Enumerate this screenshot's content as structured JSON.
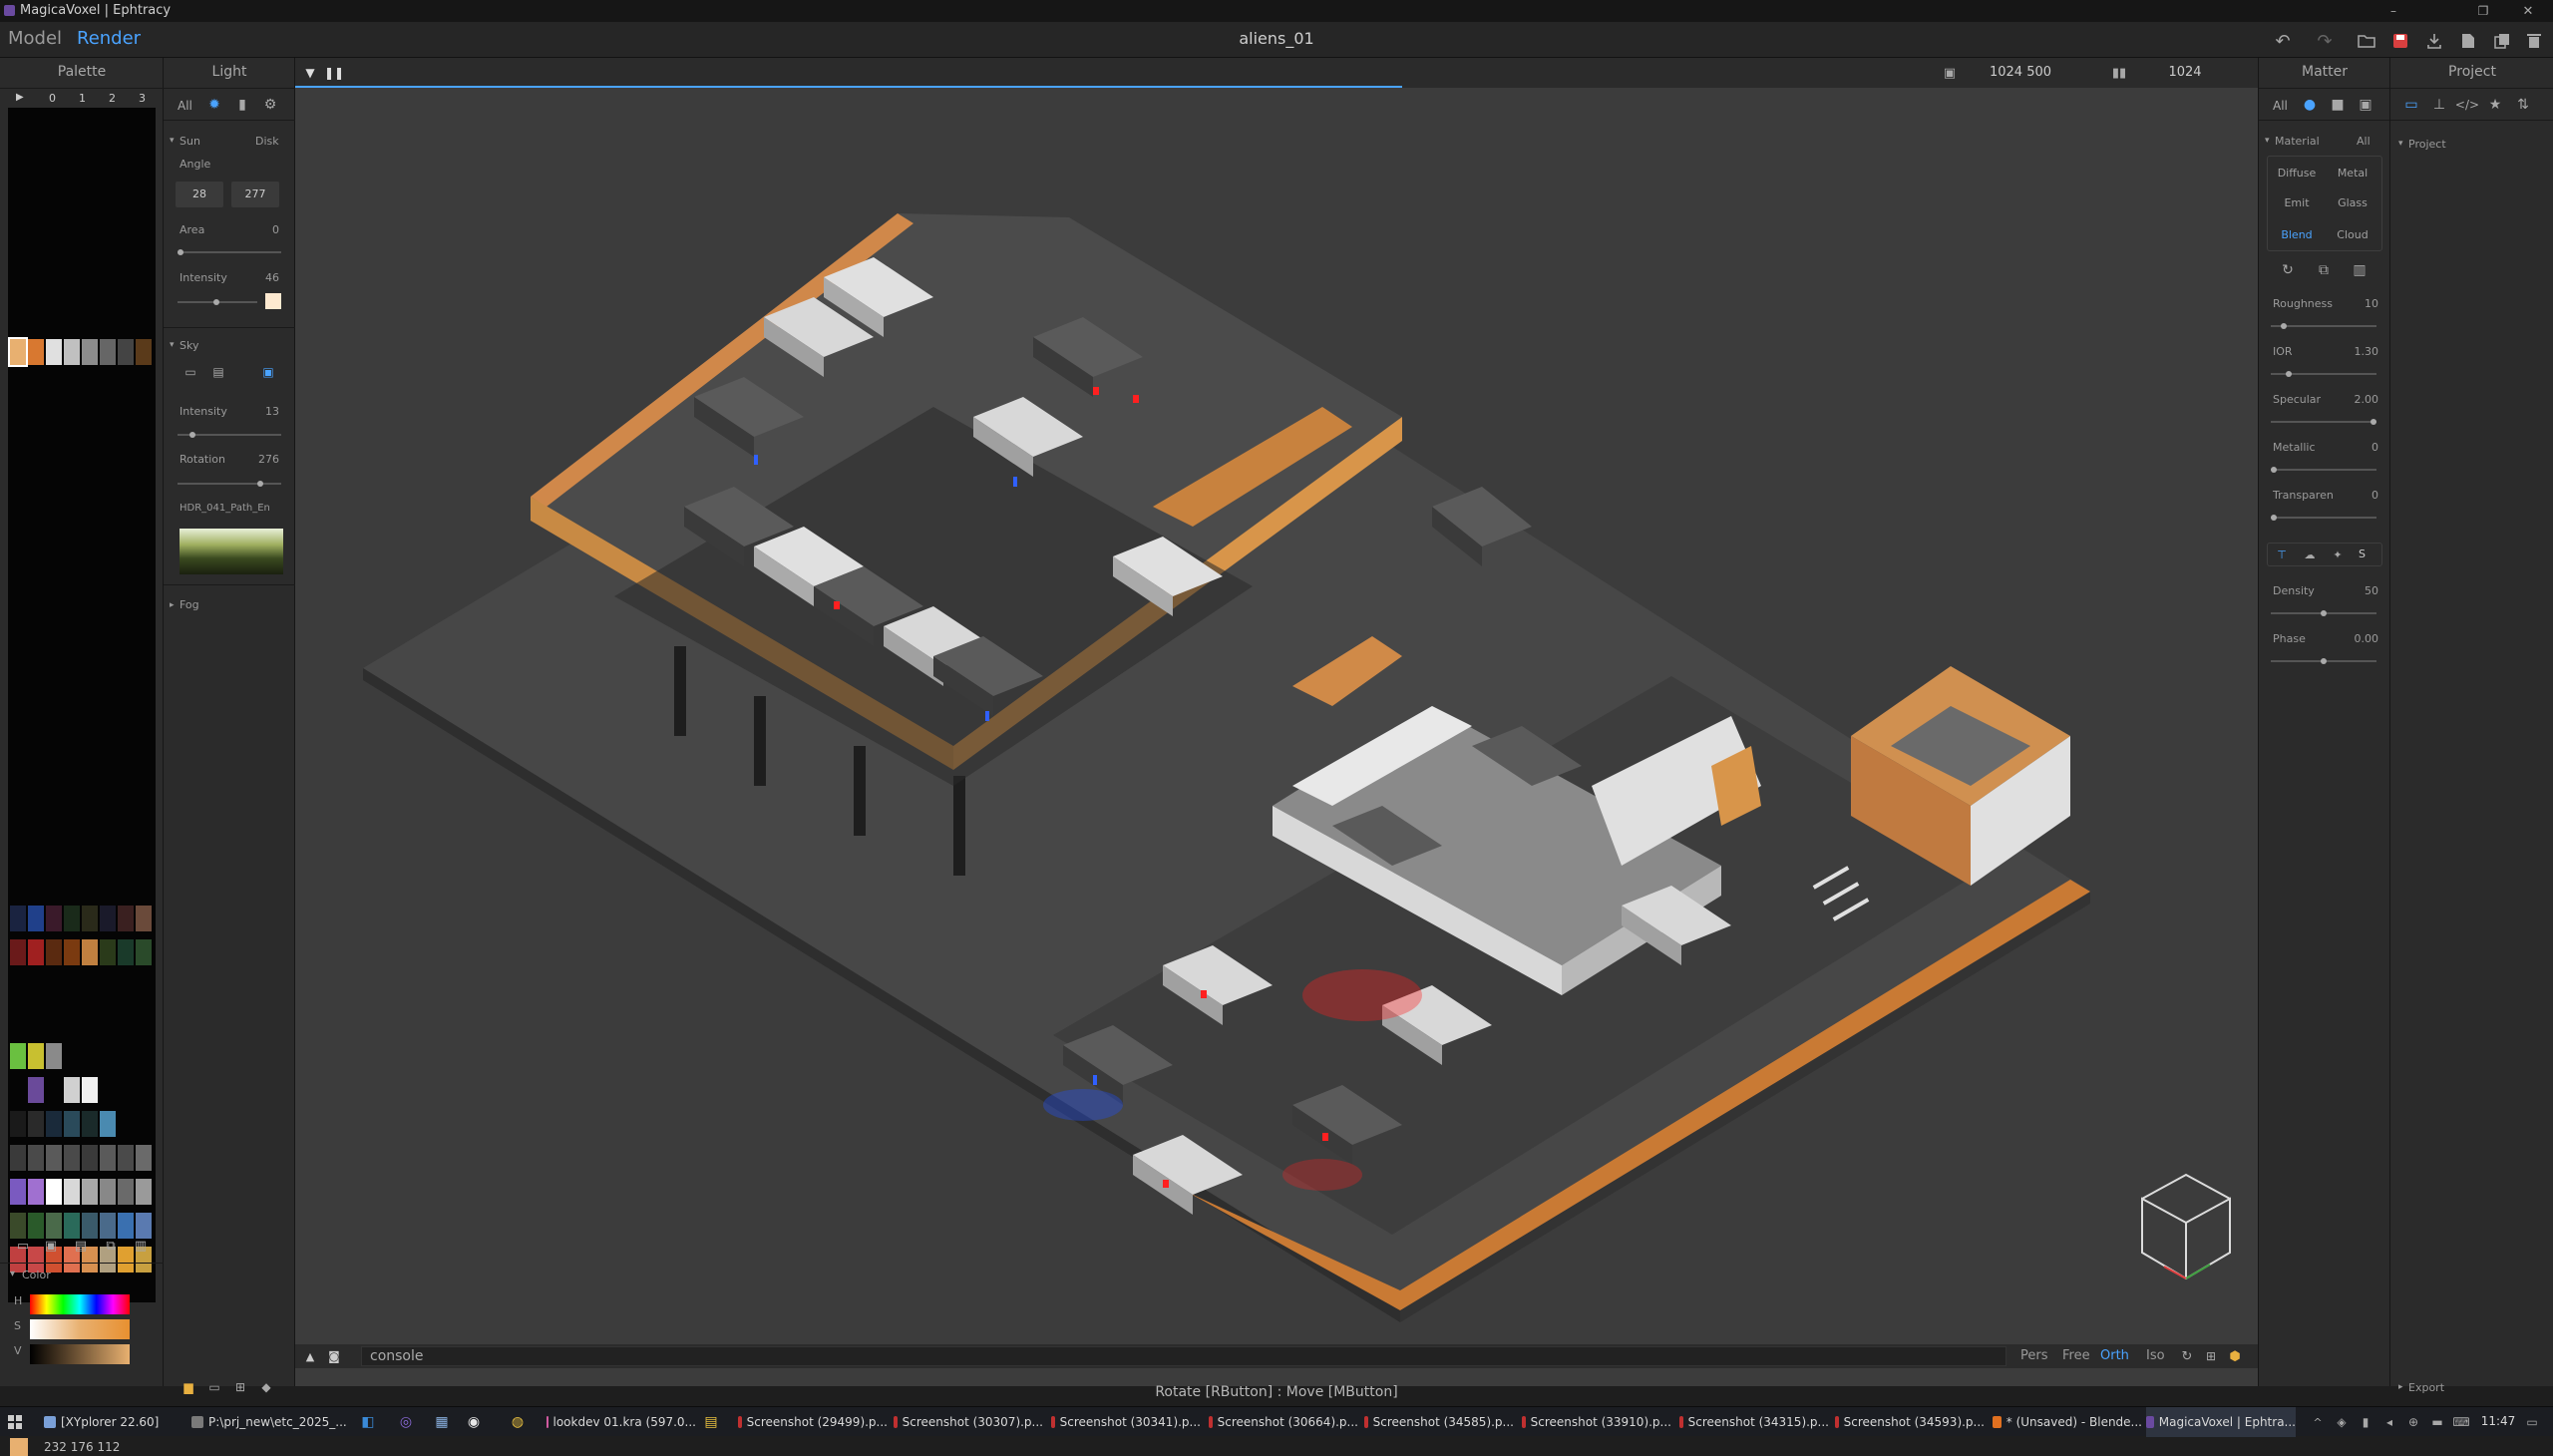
{
  "window": {
    "title": "MagicaVoxel | Ephtracy"
  },
  "menu": {
    "model": "Model",
    "render": "Render",
    "scene_name": "aliens_01",
    "accent": "#4aa3ff"
  },
  "palette": {
    "title": "Palette",
    "pages": [
      "0",
      "1",
      "2",
      "3"
    ],
    "color_section": "Color",
    "hsv_labels": [
      "H",
      "S",
      "V"
    ],
    "rgb_value": "232 176 112",
    "selected_color": "#e8b070"
  },
  "light": {
    "title": "Light",
    "tabs": [
      "All"
    ],
    "sun": {
      "label": "Sun",
      "mode": "Disk",
      "angle_label": "Angle",
      "angle_a": "28",
      "angle_b": "277",
      "area_label": "Area",
      "area": "0",
      "intensity_label": "Intensity",
      "intensity": "46"
    },
    "sky": {
      "label": "Sky",
      "intensity_label": "Intensity",
      "intensity": "13",
      "rotation_label": "Rotation",
      "rotation": "276",
      "hdr_name": "HDR_041_Path_En"
    },
    "fog": {
      "label": "Fog"
    }
  },
  "viewport": {
    "resolution": "1024 500",
    "samples": "1024",
    "console_placeholder": "console",
    "camera_modes": [
      "Pers",
      "Free",
      "Orth",
      "Iso"
    ],
    "active_camera": "Orth",
    "status": "Rotate [RButton] : Move [MButton]"
  },
  "matter": {
    "title": "Matter",
    "tab_all": "All",
    "material_label": "Material",
    "material_all": "All",
    "types": [
      "Diffuse",
      "Metal",
      "Emit",
      "Glass",
      "Blend",
      "Cloud"
    ],
    "active_type": "Blend",
    "props": [
      {
        "label": "Roughness",
        "value": "10",
        "fill": 0.1
      },
      {
        "label": "IOR",
        "value": "1.30",
        "fill": 0.15
      },
      {
        "label": "Specular",
        "value": "2.00",
        "fill": 1.0
      },
      {
        "label": "Metallic",
        "value": "0",
        "fill": 0.0
      },
      {
        "label": "Transparen",
        "value": "0",
        "fill": 0.0
      }
    ],
    "media_label": "S",
    "density_label": "Density",
    "density": "50",
    "density_fill": 0.5,
    "phase_label": "Phase",
    "phase": "0.00",
    "phase_fill": 0.5
  },
  "project": {
    "title": "Project",
    "section": "Project",
    "export": "Export"
  },
  "taskbar": {
    "items": [
      "[XYplorer 22.60]",
      "P:\\prj_new\\etc_2025_...",
      "lookdev 01.kra (597.0...",
      "Screenshot (29499).p...",
      "Screenshot (30307).p...",
      "Screenshot (30341).p...",
      "Screenshot (30664).p...",
      "Screenshot (34585).p...",
      "Screenshot (33910).p...",
      "Screenshot (34315).p...",
      "Screenshot (34593).p...",
      "* (Unsaved) - Blende...",
      "MagicaVoxel | Ephtra..."
    ],
    "clock": "11:47"
  }
}
